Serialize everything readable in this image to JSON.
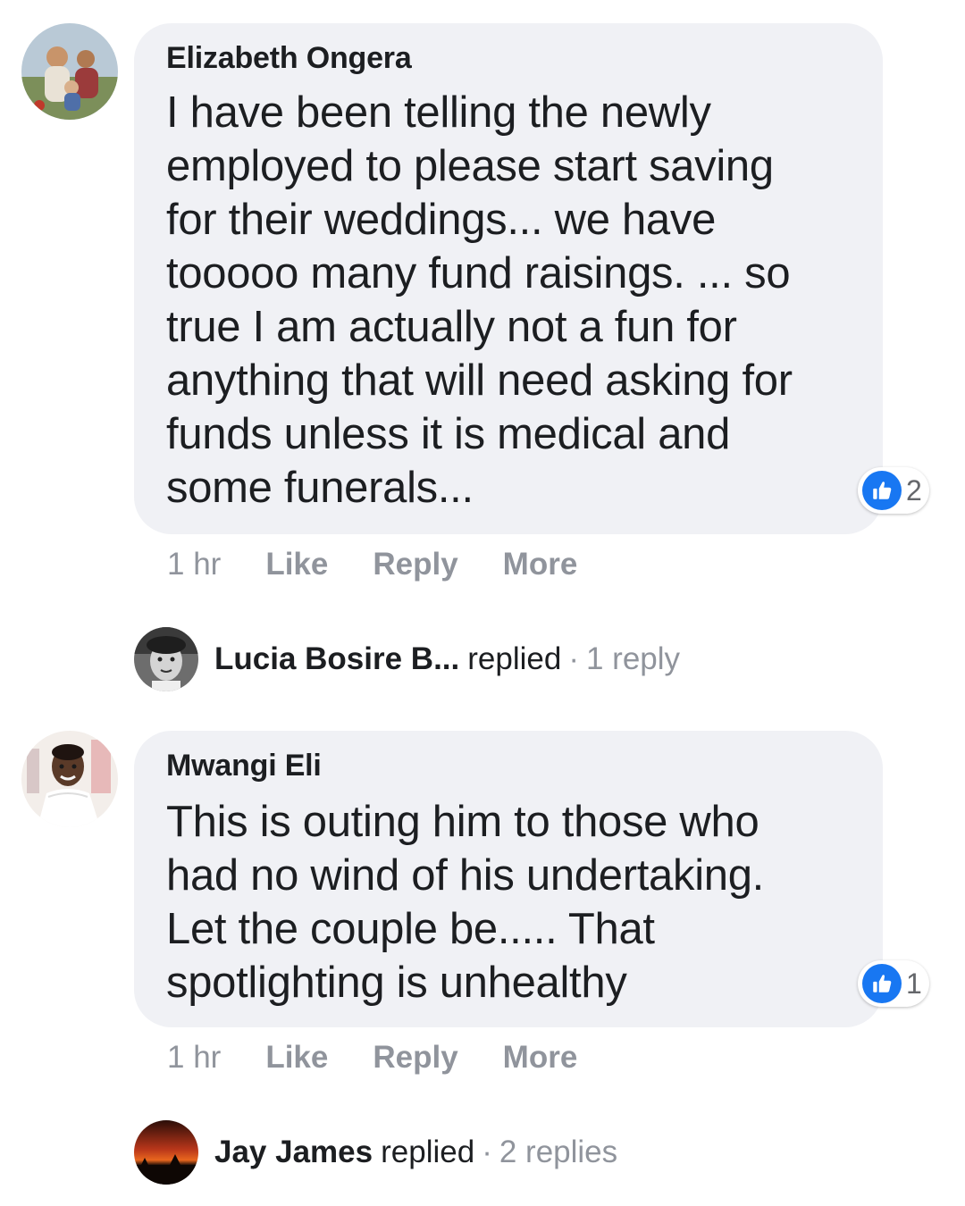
{
  "comments": [
    {
      "author": "Elizabeth Ongera",
      "lines": [
        "I have been telling the newly",
        "employed to please start saving",
        "for their weddings... we have",
        "tooooo many fund raisings. ... so",
        "true I am actually not a fun for",
        "anything that will need asking for",
        "funds unless it is medical and",
        "some funerals..."
      ],
      "reaction_icon": "like-icon",
      "reaction_count": "2",
      "time": "1 hr",
      "like_label": "Like",
      "reply_label": "Reply",
      "more_label": "More",
      "reply_summary": {
        "name": "Lucia Bosire B...",
        "verb": "replied",
        "separator": "·",
        "count": "1 reply"
      }
    },
    {
      "author": "Mwangi Eli",
      "lines": [
        "This is outing him to those who",
        "had no wind of his undertaking.",
        "Let the couple be..... That",
        "spotlighting is unhealthy"
      ],
      "reaction_icon": "like-icon",
      "reaction_count": "1",
      "time": "1 hr",
      "like_label": "Like",
      "reply_label": "Reply",
      "more_label": "More",
      "reply_summary": {
        "name": "Jay James",
        "verb": "replied",
        "separator": "·",
        "count": "2 replies"
      }
    }
  ],
  "colors": {
    "bubble": "#f0f1f5",
    "like_blue": "#1877f2",
    "meta_gray": "#90949c",
    "text": "#1c1e21"
  }
}
